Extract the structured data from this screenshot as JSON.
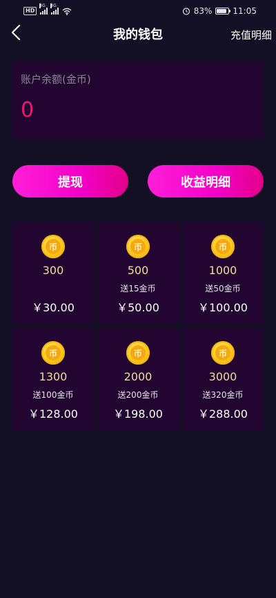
{
  "status_bar": {
    "left_badge": "HD",
    "network_1": "4G",
    "network_2": "4G",
    "battery": "83%",
    "time": "11:05",
    "battery_level": 0.83
  },
  "nav": {
    "back_icon": "chevron-left-icon",
    "title": "我的钱包",
    "right_label": "充值明细"
  },
  "balance": {
    "label": "账户余额(金币)",
    "value": "0",
    "value_color": "#e8186e"
  },
  "actions": {
    "withdraw": "提现",
    "earnings": "收益明细"
  },
  "packages": [
    {
      "amount": "300",
      "bonus": "",
      "price": "￥30.00"
    },
    {
      "amount": "500",
      "bonus": "送15金币",
      "price": "￥50.00"
    },
    {
      "amount": "1000",
      "bonus": "送50金币",
      "price": "￥100.00"
    },
    {
      "amount": "1300",
      "bonus": "送100金币",
      "price": "￥128.00"
    },
    {
      "amount": "2000",
      "bonus": "送200金币",
      "price": "￥198.00"
    },
    {
      "amount": "3000",
      "bonus": "送320金币",
      "price": "￥288.00"
    }
  ],
  "coin_glyph": "币",
  "colors": {
    "background": "#130f25",
    "card": "#220531",
    "accent_magenta": "#ff1fd8",
    "amount_gold": "#f3dca0"
  }
}
